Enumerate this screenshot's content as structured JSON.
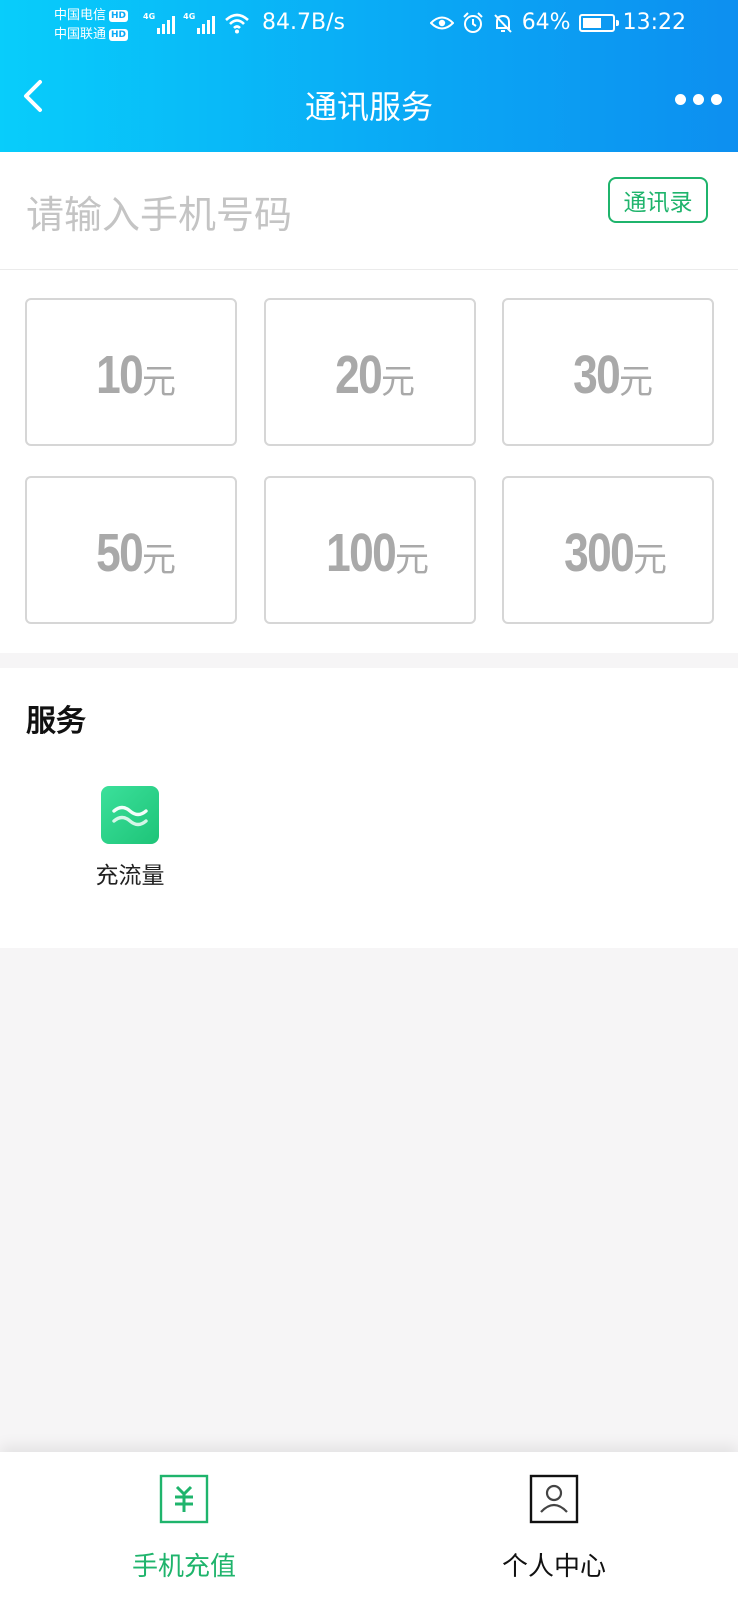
{
  "status_bar": {
    "carrier_1": "中国电信",
    "carrier_2": "中国联通",
    "hd_badge": "HD",
    "network_tag": "4G",
    "net_speed": "84.7B/s",
    "battery_percent": "64%",
    "battery_level": 0.64,
    "time": "13:22"
  },
  "nav": {
    "title": "通讯服务"
  },
  "phone": {
    "placeholder": "请输入手机号码",
    "contacts_label": "通讯录"
  },
  "amounts": [
    {
      "value": "10",
      "unit": "元"
    },
    {
      "value": "20",
      "unit": "元"
    },
    {
      "value": "30",
      "unit": "元"
    },
    {
      "value": "50",
      "unit": "元"
    },
    {
      "value": "100",
      "unit": "元"
    },
    {
      "value": "300",
      "unit": "元"
    }
  ],
  "services": {
    "title": "服务",
    "items": [
      {
        "label": "充流量",
        "icon": "wave-icon"
      }
    ]
  },
  "tab_bar": {
    "items": [
      {
        "label": "手机充值",
        "icon": "yuan-icon",
        "active": true
      },
      {
        "label": "个人中心",
        "icon": "person-icon",
        "active": false
      }
    ]
  },
  "colors": {
    "header_start": "#08cdfb",
    "header_end": "#0d8ff0",
    "accent_green": "#1fb46c",
    "amount_text": "#a9a9a9"
  }
}
